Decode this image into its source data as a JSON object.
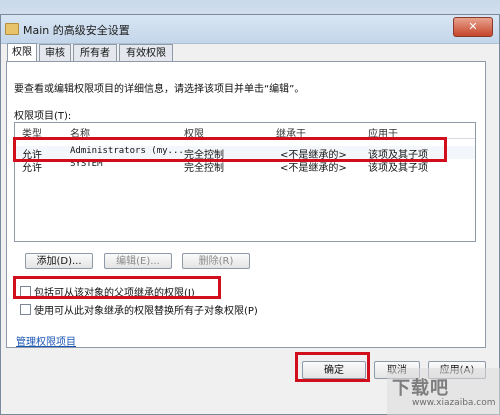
{
  "window": {
    "title": "Main 的高级安全设置",
    "close_glyph": "✕"
  },
  "tabs": [
    {
      "label": "权限",
      "active": true
    },
    {
      "label": "审核",
      "active": false
    },
    {
      "label": "所有者",
      "active": false
    },
    {
      "label": "有效权限",
      "active": false
    }
  ],
  "description": "要查看或编辑权限项目的详细信息，请选择该项目并单击“编辑”。",
  "permissions": {
    "label": "权限项目(T):",
    "columns": [
      "类型",
      "名称",
      "权限",
      "继承于",
      "应用于"
    ],
    "rows": [
      {
        "type": "允许",
        "name": "Administrators (my...",
        "permission": "完全控制",
        "inherited": "<不是继承的>",
        "applies": "该项及其子项"
      },
      {
        "type": "允许",
        "name": "SYSTEM",
        "permission": "完全控制",
        "inherited": "<不是继承的>",
        "applies": "该项及其子项"
      }
    ]
  },
  "buttons": {
    "add": "添加(D)...",
    "edit": "编辑(E)...",
    "remove": "删除(R)",
    "ok": "确定",
    "cancel": "取消",
    "apply": "应用(A)"
  },
  "checkboxes": {
    "inherit": {
      "label": "包括可从该对象的父项继承的权限(I)",
      "checked": false
    },
    "replace": {
      "label": "使用可从此对象继承的权限替换所有子对象权限(P)",
      "checked": false
    }
  },
  "link": "管理权限项目",
  "watermark": {
    "main": "下载吧",
    "sub": "www.xiazaiba.com"
  },
  "colors": {
    "highlight": "#d10f1c",
    "link": "#1a56b5",
    "selected_row": "#f3f6fa"
  }
}
